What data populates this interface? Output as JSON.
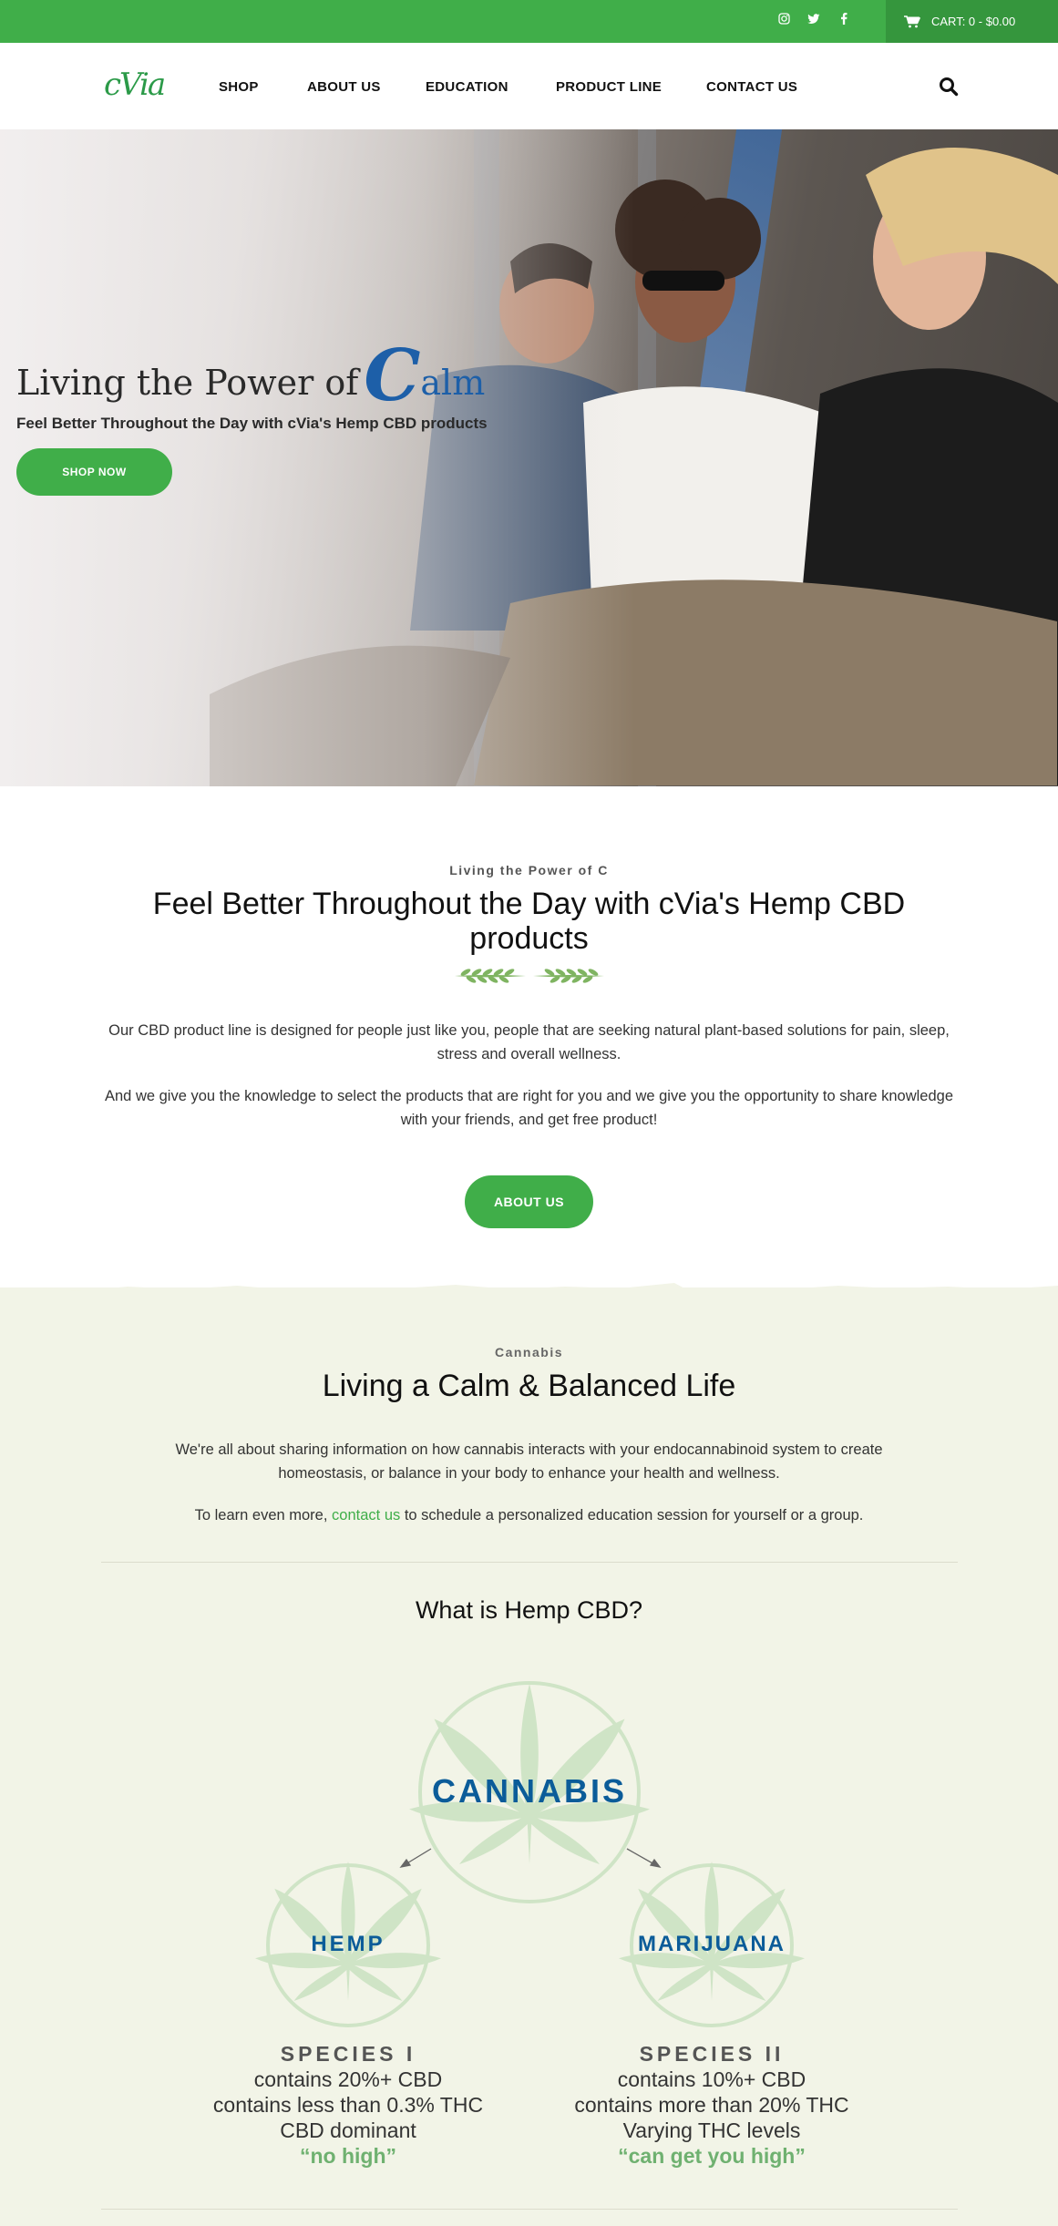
{
  "topbar": {
    "social": [
      "instagram-icon",
      "twitter-icon",
      "facebook-icon"
    ],
    "cart_label": "CART: 0 - $0.00"
  },
  "header": {
    "logo_text": "cVia",
    "nav": [
      "SHOP",
      "ABOUT US",
      "EDUCATION",
      "PRODUCT LINE",
      "CONTACT US"
    ]
  },
  "hero": {
    "title_prefix": "Living the Power of",
    "title_c": "C",
    "title_suffix": "alm",
    "subtitle": "Feel Better Throughout the Day with cVia's Hemp CBD products",
    "button": "SHOP NOW"
  },
  "intro": {
    "eyebrow": "Living the Power of C",
    "heading": "Feel Better Throughout the Day with cVia's Hemp CBD products",
    "para1": "Our CBD product line is designed for people just like you, people that are seeking natural plant-based solutions for pain, sleep, stress and overall wellness.",
    "para2": "And we give you the knowledge to select the products that are right for you and we give you the opportunity to share knowledge with your friends, and get free product!",
    "button": "ABOUT US"
  },
  "cannabis": {
    "eyebrow": "Cannabis",
    "heading": "Living a Calm & Balanced Life",
    "para1": "We're all about sharing information on how cannabis interacts with your endocannabinoid system to create homeostasis, or balance in your body to enhance your health and wellness.",
    "para2_before": "To learn even more, ",
    "para2_link": "contact us",
    "para2_after": " to schedule a personalized education session for yourself or a group.",
    "subheading": "What is Hemp CBD?"
  },
  "diagram": {
    "root": "CANNABIS",
    "left": "HEMP",
    "right": "MARIJUANA",
    "species1": {
      "title": "SPECIES I",
      "lines": [
        "contains 20%+ CBD",
        "contains less than 0.3% THC",
        "CBD dominant"
      ],
      "quote": "“no high”"
    },
    "species2": {
      "title": "SPECIES II",
      "lines": [
        "contains 10%+ CBD",
        "contains more than 20% THC",
        "Varying THC levels"
      ],
      "quote": "“can get you high”"
    }
  },
  "colors": {
    "brand_green": "#40ae49",
    "brand_blue": "#0b5c99",
    "beige_bg": "#f2f4e7"
  }
}
